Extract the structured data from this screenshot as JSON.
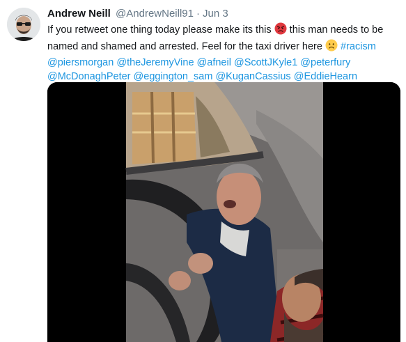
{
  "tweet": {
    "display_name": "Andrew Neill",
    "handle": "@AndrewNeill91",
    "separator": "·",
    "date": "Jun 3",
    "text_1": "If you retweet one thing today please make its this",
    "text_2": "this man needs to be named and shamed and arrested. Feel for the taxi driver here",
    "hashtag": "#racism",
    "mentions": [
      "@piersmorgan",
      "@theJeremyVine",
      "@afneil",
      "@ScottJKyle1",
      "@peterfury",
      "@McDonaghPeter",
      "@eggington_sam",
      "@KuganCassius",
      "@EddieHearn"
    ],
    "emoji_1": "angry-face",
    "emoji_2": "frowning-face"
  },
  "colors": {
    "link": "#1b95e0",
    "text": "#14171a",
    "secondary": "#657786"
  }
}
